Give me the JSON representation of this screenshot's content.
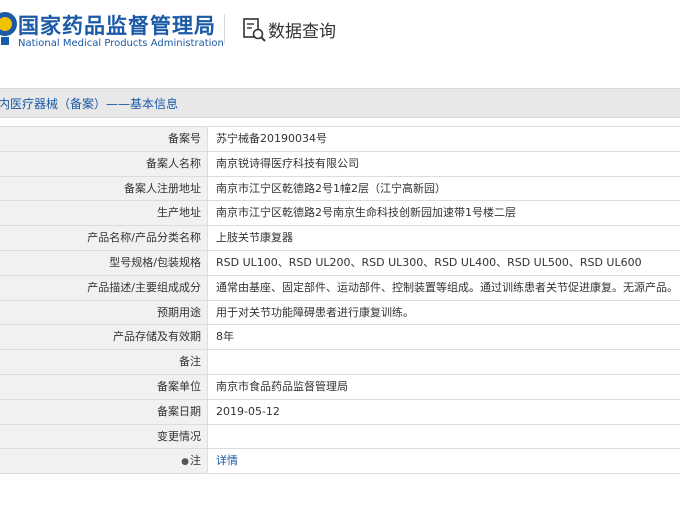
{
  "header": {
    "site_title": "国家药品监督管理局",
    "site_subtitle": "National Medical Products Administration",
    "query_title": "数据查询"
  },
  "breadcrumb": "内医疗器械（备案）——基本信息",
  "rows": [
    {
      "label": "备案号",
      "value": "苏宁械备20190034号"
    },
    {
      "label": "备案人名称",
      "value": "南京锐诗得医疗科技有限公司"
    },
    {
      "label": "备案人注册地址",
      "value": "南京市江宁区乾德路2号1幢2层（江宁高新园）"
    },
    {
      "label": "生产地址",
      "value": "南京市江宁区乾德路2号南京生命科技创新园加速带1号楼二层"
    },
    {
      "label": "产品名称/产品分类名称",
      "value": "上肢关节康复器"
    },
    {
      "label": "型号规格/包装规格",
      "value": "RSD UL100、RSD UL200、RSD UL300、RSD UL400、RSD UL500、RSD UL600"
    },
    {
      "label": "产品描述/主要组成成分",
      "value": "通常由基座、固定部件、运动部件、控制装置等组成。通过训练患者关节促进康复。无源产品。"
    },
    {
      "label": "预期用途",
      "value": "用于对关节功能障碍患者进行康复训练。"
    },
    {
      "label": "产品存储及有效期",
      "value": "8年"
    },
    {
      "label": "备注",
      "value": ""
    },
    {
      "label": "备案单位",
      "value": "南京市食品药品监督管理局"
    },
    {
      "label": "备案日期",
      "value": "2019-05-12"
    },
    {
      "label": "变更情况",
      "value": ""
    },
    {
      "label": "注",
      "value": "详情"
    }
  ],
  "colors": {
    "brand_blue": "#1a5aa6",
    "label_bg": "#f1f1f1"
  }
}
